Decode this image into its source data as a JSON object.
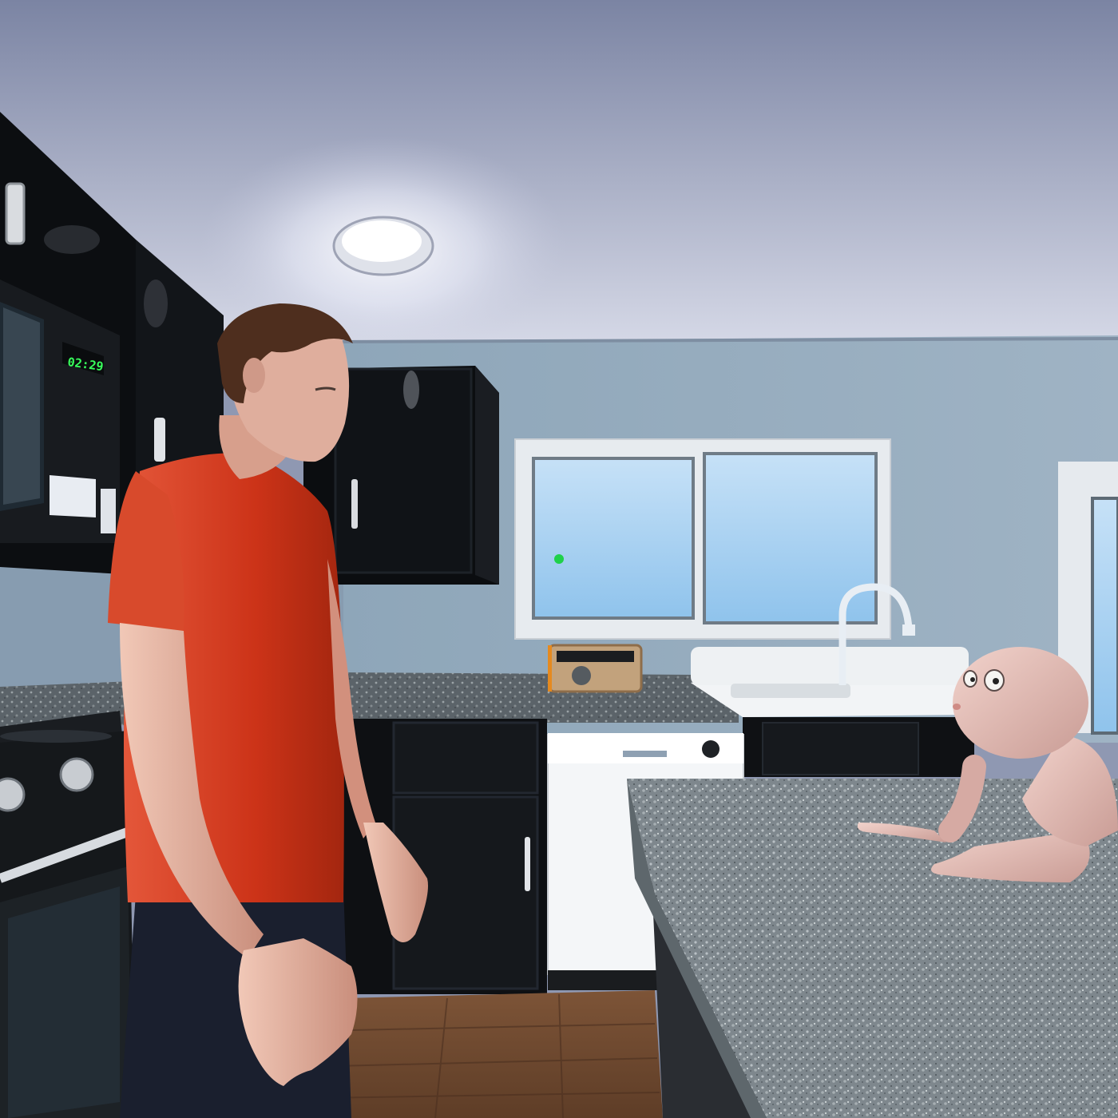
{
  "scene": {
    "microwave_clock": "02:29",
    "crosshair_color": "#1fd14a",
    "colors": {
      "ceiling": "#c9cce0",
      "wall": "#8ea6ba",
      "cabinet": "#0d0f12",
      "countertop": "#8a9298",
      "floor": "#6e4a30",
      "shirt": "#d33a22",
      "skin": "#e8b7a6",
      "creature": "#e7c1bb"
    }
  }
}
